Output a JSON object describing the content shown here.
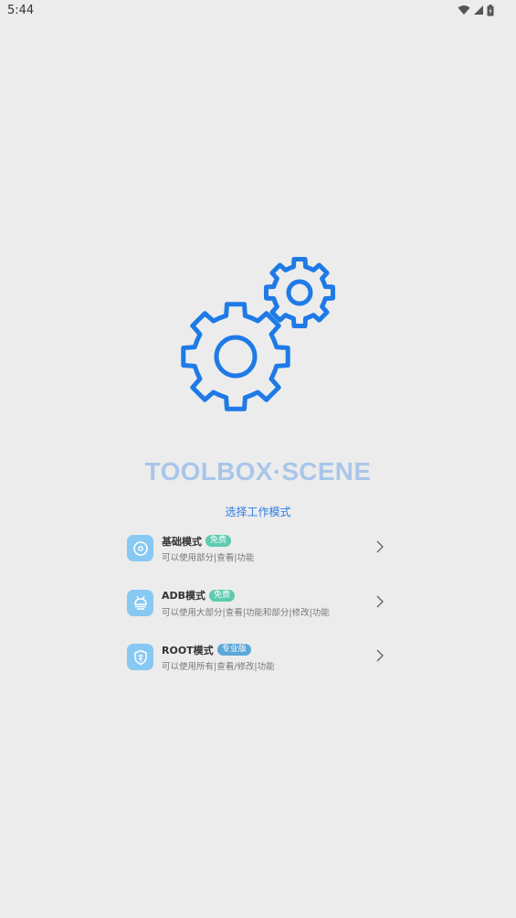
{
  "status_bar": {
    "time": "5:44",
    "icons": [
      "wifi-icon",
      "signal-icon",
      "battery-icon"
    ]
  },
  "app": {
    "title": "TOOLBOX·SCENE",
    "mode_heading": "选择工作模式"
  },
  "colors": {
    "accent": "#2c7be5",
    "gear": "#1e7ae6",
    "title": "#a9c6ea",
    "icon_bg": "#88c9f4",
    "badge_free": "#5ecbb0",
    "badge_pro": "#5aa7d8",
    "background": "#ececec"
  },
  "modes": [
    {
      "title": "基础模式",
      "badge": "免费",
      "description": "可以使用部分|查看|功能",
      "icon": "disc-icon"
    },
    {
      "title": "ADB模式",
      "badge": "免费",
      "description": "可以使用大部分|查看|功能和部分|修改|功能",
      "icon": "android-icon"
    },
    {
      "title": "ROOT模式",
      "badge": "专业版",
      "description": "可以使用所有|查看/修改|功能",
      "icon": "shield-icon"
    }
  ]
}
